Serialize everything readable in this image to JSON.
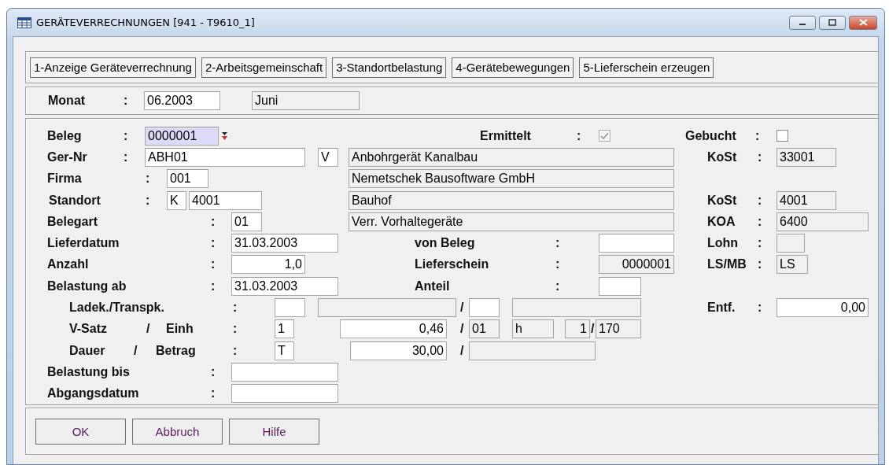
{
  "window": {
    "title": "GERÄTEVERRECHNUNGEN [941 - T9610_1]"
  },
  "tab_buttons": [
    "1-Anzeige Geräteverrechnung",
    "2-Arbeitsgemeinschaft",
    "3-Standortbelastung",
    "4-Gerätebewegungen",
    "5-Lieferschein erzeugen"
  ],
  "month_row": [
    {
      "kind": "label",
      "text": "Monat"
    },
    {
      "kind": "colon",
      "text": ":"
    },
    {
      "kind": "input",
      "value": "06.2003",
      "focused": false
    },
    {
      "kind": "readonly",
      "value": "Juni"
    }
  ],
  "form_rows": [
    [
      {
        "kind": "label",
        "text": "Beleg"
      },
      {
        "kind": "colon",
        "text": ":"
      },
      {
        "kind": "input",
        "value": "0000001",
        "focused": true
      },
      {
        "kind": "dropdown"
      },
      {
        "kind": "label",
        "text": "Ermittelt"
      },
      {
        "kind": "colon",
        "text": ":"
      },
      {
        "kind": "checkbox",
        "checked": true,
        "disabled": true
      },
      {
        "kind": "label",
        "text": "Gebucht"
      },
      {
        "kind": "colon",
        "text": ":"
      },
      {
        "kind": "checkbox",
        "checked": false,
        "disabled": false
      }
    ],
    [
      {
        "kind": "label",
        "text": "Ger-Nr"
      },
      {
        "kind": "colon",
        "text": ":"
      },
      {
        "kind": "input",
        "value": "ABH01",
        "focused": false
      },
      {
        "kind": "input",
        "value": "V",
        "focused": false
      },
      {
        "kind": "readonly",
        "value": "Anbohrgerät Kanalbau"
      },
      {
        "kind": "label",
        "text": "KoSt"
      },
      {
        "kind": "colon",
        "text": ":"
      },
      {
        "kind": "readonly",
        "value": "33001"
      }
    ],
    [
      {
        "kind": "label",
        "text": "Firma"
      },
      {
        "kind": "colon",
        "text": ":"
      },
      {
        "kind": "input",
        "value": "001",
        "focused": false
      },
      {
        "kind": "readonly",
        "value": "Nemetschek Bausoftware GmbH"
      }
    ],
    [
      {
        "kind": "label",
        "text": "Standort"
      },
      {
        "kind": "colon",
        "text": ":"
      },
      {
        "kind": "input",
        "value": "K",
        "focused": false
      },
      {
        "kind": "input",
        "value": "4001",
        "focused": false
      },
      {
        "kind": "readonly",
        "value": "Bauhof"
      },
      {
        "kind": "label",
        "text": "KoSt"
      },
      {
        "kind": "colon",
        "text": ":"
      },
      {
        "kind": "readonly",
        "value": "4001"
      }
    ],
    [
      {
        "kind": "label",
        "text": "Belegart"
      },
      {
        "kind": "colon",
        "text": ":"
      },
      {
        "kind": "input",
        "value": "01",
        "focused": false
      },
      {
        "kind": "readonly",
        "value": "Verr. Vorhaltegeräte"
      },
      {
        "kind": "label",
        "text": "KOA"
      },
      {
        "kind": "colon",
        "text": ":"
      },
      {
        "kind": "readonly",
        "value": "6400"
      }
    ],
    [
      {
        "kind": "label",
        "text": "Lieferdatum"
      },
      {
        "kind": "colon",
        "text": ":"
      },
      {
        "kind": "input",
        "value": "31.03.2003",
        "focused": false
      },
      {
        "kind": "label",
        "text": "von Beleg"
      },
      {
        "kind": "colon",
        "text": ":"
      },
      {
        "kind": "input",
        "focused": false
      },
      {
        "kind": "label",
        "text": "Lohn"
      },
      {
        "kind": "colon",
        "text": ":"
      },
      {
        "kind": "readonly"
      }
    ],
    [
      {
        "kind": "label",
        "text": "Anzahl"
      },
      {
        "kind": "colon",
        "text": ":"
      },
      {
        "kind": "input",
        "value": "1,0",
        "focused": false
      },
      {
        "kind": "label",
        "text": "Lieferschein"
      },
      {
        "kind": "colon",
        "text": ":"
      },
      {
        "kind": "readonly",
        "value": "0000001"
      },
      {
        "kind": "label",
        "text": "LS/MB"
      },
      {
        "kind": "colon",
        "text": ":"
      },
      {
        "kind": "readonly",
        "value": "LS"
      }
    ],
    [
      {
        "kind": "label",
        "text": "Belastung ab"
      },
      {
        "kind": "colon",
        "text": ":"
      },
      {
        "kind": "input",
        "value": "31.03.2003",
        "focused": false
      },
      {
        "kind": "label",
        "text": "Anteil"
      },
      {
        "kind": "colon",
        "text": ":"
      },
      {
        "kind": "input",
        "focused": false
      }
    ],
    [
      {
        "kind": "label",
        "text": "Ladek./Transpk."
      },
      {
        "kind": "colon",
        "text": ":"
      },
      {
        "kind": "input",
        "focused": false
      },
      {
        "kind": "readonly"
      },
      {
        "kind": "slash",
        "text": "/"
      },
      {
        "kind": "input",
        "focused": false
      },
      {
        "kind": "readonly"
      },
      {
        "kind": "label",
        "text": "Entf."
      },
      {
        "kind": "colon",
        "text": ":"
      },
      {
        "kind": "input",
        "value": "0,00",
        "focused": false
      }
    ],
    [
      {
        "kind": "label",
        "text": "V-Satz"
      },
      {
        "kind": "slash",
        "text": "/"
      },
      {
        "kind": "label",
        "text": "Einh"
      },
      {
        "kind": "colon",
        "text": ":"
      },
      {
        "kind": "input",
        "value": "1",
        "focused": false
      },
      {
        "kind": "input",
        "value": "0,46",
        "focused": false
      },
      {
        "kind": "slash",
        "text": "/"
      },
      {
        "kind": "readonly",
        "value": "01"
      },
      {
        "kind": "readonly",
        "value": "h"
      },
      {
        "kind": "readonly",
        "value": "1"
      },
      {
        "kind": "slash",
        "text": "/"
      },
      {
        "kind": "readonly",
        "value": "170"
      }
    ],
    [
      {
        "kind": "label",
        "text": "Dauer"
      },
      {
        "kind": "slash",
        "text": "/"
      },
      {
        "kind": "label",
        "text": "Betrag"
      },
      {
        "kind": "colon",
        "text": ":"
      },
      {
        "kind": "input",
        "value": "T",
        "focused": false
      },
      {
        "kind": "input",
        "value": "30,00",
        "focused": false
      },
      {
        "kind": "slash",
        "text": "/"
      },
      {
        "kind": "readonly"
      }
    ],
    [
      {
        "kind": "label",
        "text": "Belastung bis"
      },
      {
        "kind": "colon",
        "text": ":"
      },
      {
        "kind": "input",
        "focused": false
      }
    ],
    [
      {
        "kind": "label",
        "text": "Abgangsdatum"
      },
      {
        "kind": "colon",
        "text": ":"
      },
      {
        "kind": "input",
        "focused": false
      }
    ]
  ],
  "buttons": [
    "OK",
    "Abbruch",
    "Hilfe"
  ]
}
